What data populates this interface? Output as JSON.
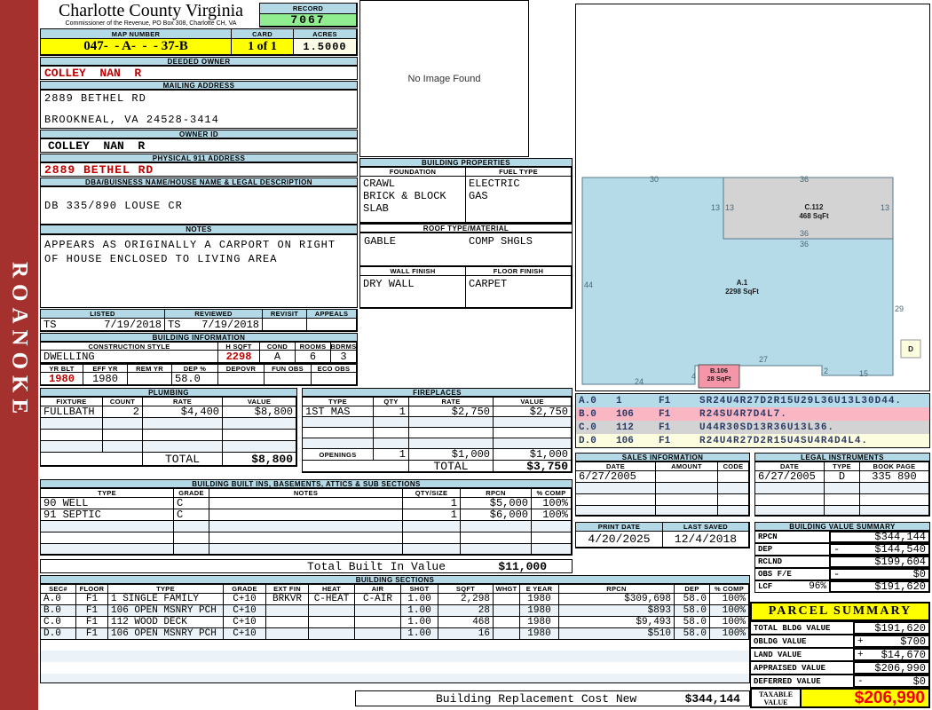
{
  "colors": {
    "sidebar_red": "#A5312E",
    "header_blue": "#B3D9E6",
    "highlight_yellow": "#FFFF00",
    "record_green": "#90EE90",
    "acres_cream": "#FCFCE6",
    "value_red": "#C00000",
    "taxable_red": "#F00000",
    "sketch_blue": "#B5DBE9",
    "sketch_gray": "#D3D3D3",
    "sketch_pink": "#F595A8",
    "sketch_yellow": "#FCFCDE"
  },
  "sidebar": {
    "label": "ROANOKE"
  },
  "header": {
    "county": "Charlotte County Virginia",
    "subtitle": "Commissioner of the Revenue, PO Box 308, Charlotte CH, VA",
    "record_label": "RECORD",
    "record_value": "7067",
    "map_label": "MAP NUMBER",
    "map_value": "047-  - A-  -  - 37-B",
    "card_label": "CARD",
    "card_value": "1 of 1",
    "acres_label": "ACRES",
    "acres_value": "1.5000"
  },
  "owner": {
    "deeded_label": "DEEDED OWNER",
    "deeded": "COLLEY  NAN  R",
    "mailing_label": "MAILING ADDRESS",
    "mailing_line1": "2889 BETHEL RD",
    "mailing_line2": "BROOKNEAL, VA 24528-3414",
    "owner_id_label": "OWNER ID",
    "owner_id": "COLLEY  NAN  R",
    "physical_label": "PHYSICAL 911 ADDRESS",
    "physical": "2889 BETHEL RD",
    "dba_label": "DBA/BUISNESS NAME/HOUSE NAME & LEGAL DESCRIPTION",
    "dba": "DB 335/890 LOUSE CR",
    "notes_label": "NOTES",
    "notes_line1": "APPEARS AS ORIGINALLY A CARPORT ON RIGHT",
    "notes_line2": "OF HOUSE ENCLOSED TO LIVING AREA"
  },
  "visit": {
    "listed_label": "LISTED",
    "reviewed_label": "REVIEWED",
    "revisit_label": "REVISIT",
    "appeals_label": "APPEALS",
    "listed_by": "TS",
    "listed_date": "7/19/2018",
    "reviewed_by": "TS",
    "reviewed_date": "7/19/2018"
  },
  "building_info": {
    "title": "BUILDING INFORMATION",
    "style_label": "CONSTRUCTION STYLE",
    "style": "DWELLING",
    "hsqft_label": "H SQFT",
    "hsqft": "2298",
    "cond_label": "COND",
    "cond": "A",
    "rooms_label": "ROOMS",
    "rooms": "6",
    "bdrms_label": "BDRMS",
    "bdrms": "3",
    "yrblt_label": "YR BLT",
    "yrblt": "1980",
    "effyr_label": "EFF YR",
    "effyr": "1980",
    "remyr_label": "REM YR",
    "remyr": "",
    "dep_label": "DEP %",
    "dep": "58.0",
    "depovr_label": "DEPOVR",
    "depovr": "",
    "funobs_label": "FUN OBS",
    "funobs": "",
    "ecoobs_label": "ECO OBS",
    "ecoobs": ""
  },
  "plumbing": {
    "title": "PLUMBING",
    "h_fixture": "FIXTURE",
    "h_count": "COUNT",
    "h_rate": "RATE",
    "h_value": "VALUE",
    "rows": [
      {
        "fixture": "FULLBATH",
        "count": "2",
        "rate": "$4,400",
        "value": "$8,800"
      }
    ],
    "total_label": "TOTAL",
    "total": "$8,800"
  },
  "fireplaces": {
    "title": "FIREPLACES",
    "h_type": "TYPE",
    "h_qty": "QTY",
    "h_rate": "RATE",
    "h_value": "VALUE",
    "rows": [
      {
        "type": "1ST MAS",
        "qty": "1",
        "rate": "$2,750",
        "value": "$2,750"
      }
    ],
    "openings_label": "OPENINGS",
    "openings_qty": "1",
    "openings_rate": "$1,000",
    "openings_value": "$1,000",
    "total_label": "TOTAL",
    "total": "$3,750"
  },
  "built_ins": {
    "title": "BUILDING BUILT INS, BASEMENTS, ATTICS & SUB SECTIONS",
    "h_type": "TYPE",
    "h_grade": "GRADE",
    "h_notes": "NOTES",
    "h_qty": "QTY/SIZE",
    "h_rpcn": "RPCN",
    "h_comp": "% COMP",
    "rows": [
      {
        "type": "90 WELL",
        "grade": "C",
        "notes": "",
        "qty": "1",
        "rpcn": "$5,000",
        "comp": "100%"
      },
      {
        "type": "91 SEPTIC",
        "grade": "C",
        "notes": "",
        "qty": "1",
        "rpcn": "$6,000",
        "comp": "100%"
      }
    ],
    "total_label": "Total Built In Value",
    "total": "$11,000"
  },
  "building_sections": {
    "title": "BUILDING SECTIONS",
    "headers": {
      "sec": "SEC#",
      "floor": "FLOOR",
      "type": "TYPE",
      "grade": "GRADE",
      "extfin": "EXT FIN",
      "heat": "HEAT",
      "air": "AIR",
      "shgt": "SHGT",
      "sqft": "SQFT",
      "whgt": "WHGT",
      "eyear": "E YEAR",
      "rpcn": "RPCN",
      "dep": "DEP",
      "comp": "% COMP"
    },
    "rows": [
      {
        "sec": "A.0",
        "floor": "F1",
        "type": "1 SINGLE FAMILY",
        "grade": "C+10",
        "extfin": "BRKVR",
        "heat": "C-HEAT",
        "air": "C-AIR",
        "shgt": "1.00",
        "sqft": "2,298",
        "whgt": "",
        "eyear": "1980",
        "rpcn": "$309,698",
        "dep": "58.0",
        "comp": "100%"
      },
      {
        "sec": "B.0",
        "floor": "F1",
        "type": "106 OPEN MSNRY PCH",
        "grade": "C+10",
        "extfin": "",
        "heat": "",
        "air": "",
        "shgt": "1.00",
        "sqft": "28",
        "whgt": "",
        "eyear": "1980",
        "rpcn": "$893",
        "dep": "58.0",
        "comp": "100%"
      },
      {
        "sec": "C.0",
        "floor": "F1",
        "type": "112 WOOD DECK",
        "grade": "C+10",
        "extfin": "",
        "heat": "",
        "air": "",
        "shgt": "1.00",
        "sqft": "468",
        "whgt": "",
        "eyear": "1980",
        "rpcn": "$9,493",
        "dep": "58.0",
        "comp": "100%"
      },
      {
        "sec": "D.0",
        "floor": "F1",
        "type": "106 OPEN MSNRY PCH",
        "grade": "C+10",
        "extfin": "",
        "heat": "",
        "air": "",
        "shgt": "1.00",
        "sqft": "16",
        "whgt": "",
        "eyear": "1980",
        "rpcn": "$510",
        "dep": "58.0",
        "comp": "100%"
      }
    ]
  },
  "replacement": {
    "label": "Building Replacement Cost New",
    "value": "$344,144"
  },
  "image_panel": {
    "text": "No Image Found"
  },
  "building_properties": {
    "title": "BUILDING PROPERTIES",
    "foundation_label": "FOUNDATION",
    "foundation1": "CRAWL",
    "foundation2": "BRICK & BLOCK",
    "foundation3": "SLAB",
    "fuel_label": "FUEL TYPE",
    "fuel1": "ELECTRIC",
    "fuel2": "GAS",
    "roof_label": "ROOF TYPE/MATERIAL",
    "roof_type": "GABLE",
    "roof_material": "COMP SHGLS",
    "wall_label": "WALL FINISH",
    "wall": "DRY WALL",
    "floor_label": "FLOOR FINISH",
    "floor": "CARPET"
  },
  "sketch": {
    "a_label": "A.1",
    "a_sqft": "2298 SqFt",
    "c_label": "C.112",
    "c_sqft": "468 SqFt",
    "b_label": "B.106",
    "b_sqft": "28 SqFt",
    "d_label": "D",
    "dims": {
      "top": "30",
      "gray_top": "36",
      "left_out_13": "13",
      "left_in_13": "13",
      "right_13": "13",
      "gray_bottom": "36",
      "below_gray": "36",
      "left_44": "44",
      "right_29": "29",
      "notch_27": "27",
      "step_2": "2",
      "bottom_15": "15",
      "bottom_24": "24",
      "porch_4": "4"
    }
  },
  "sketch_vectors": {
    "rows": [
      {
        "sec": "A.0",
        "code": "1",
        "floor": "F1",
        "vector": "SR24U4R27D2R15U29L36U13L30D44."
      },
      {
        "sec": "B.0",
        "code": "106",
        "floor": "F1",
        "vector": "R24SU4R7D4L7."
      },
      {
        "sec": "C.0",
        "code": "112",
        "floor": "F1",
        "vector": "U44R30SD13R36U13L36."
      },
      {
        "sec": "D.0",
        "code": "106",
        "floor": "F1",
        "vector": "R24U4R27D2R15U4SU4R4D4L4."
      }
    ]
  },
  "sales": {
    "title": "SALES INFORMATION",
    "h_date": "DATE",
    "h_amount": "AMOUNT",
    "h_code": "CODE",
    "rows": [
      {
        "date": "6/27/2005",
        "amount": "",
        "code": ""
      }
    ]
  },
  "legal": {
    "title": "LEGAL INSTRUMENTS",
    "h_date": "DATE",
    "h_type": "TYPE",
    "h_book": "BOOK PAGE",
    "rows": [
      {
        "date": "6/27/2005",
        "type": "D",
        "book": "335 890"
      }
    ]
  },
  "print_info": {
    "print_label": "PRINT DATE",
    "print_date": "4/20/2025",
    "saved_label": "LAST SAVED",
    "saved_date": "12/4/2018"
  },
  "value_summary": {
    "title": "BUILDING VALUE SUMMARY",
    "rpcn_label": "RPCN",
    "rpcn": "$344,144",
    "dep_label": "DEP",
    "dep_sign": "-",
    "dep": "$144,540",
    "rclnd_label": "RCLND",
    "rclnd": "$199,604",
    "obs_label": "OBS F/E",
    "obs_sign": "-",
    "obs": "$0",
    "lcf_label": "LCF",
    "lcf_pct": "96%",
    "lcf": "$191,620"
  },
  "parcel_summary": {
    "title": "PARCEL SUMMARY",
    "rows": [
      {
        "label": "TOTAL BLDG VALUE",
        "sign": "",
        "value": "$191,620"
      },
      {
        "label": "OBLDG VALUE",
        "sign": "+",
        "value": "$700"
      },
      {
        "label": "LAND VALUE",
        "sign": "+",
        "value": "$14,670"
      },
      {
        "label": "APPRAISED VALUE",
        "sign": "",
        "value": "$206,990"
      },
      {
        "label": "DEFERRED VALUE",
        "sign": "-",
        "value": "$0"
      }
    ],
    "taxable_label": "TAXABLE VALUE",
    "taxable_value": "$206,990"
  }
}
